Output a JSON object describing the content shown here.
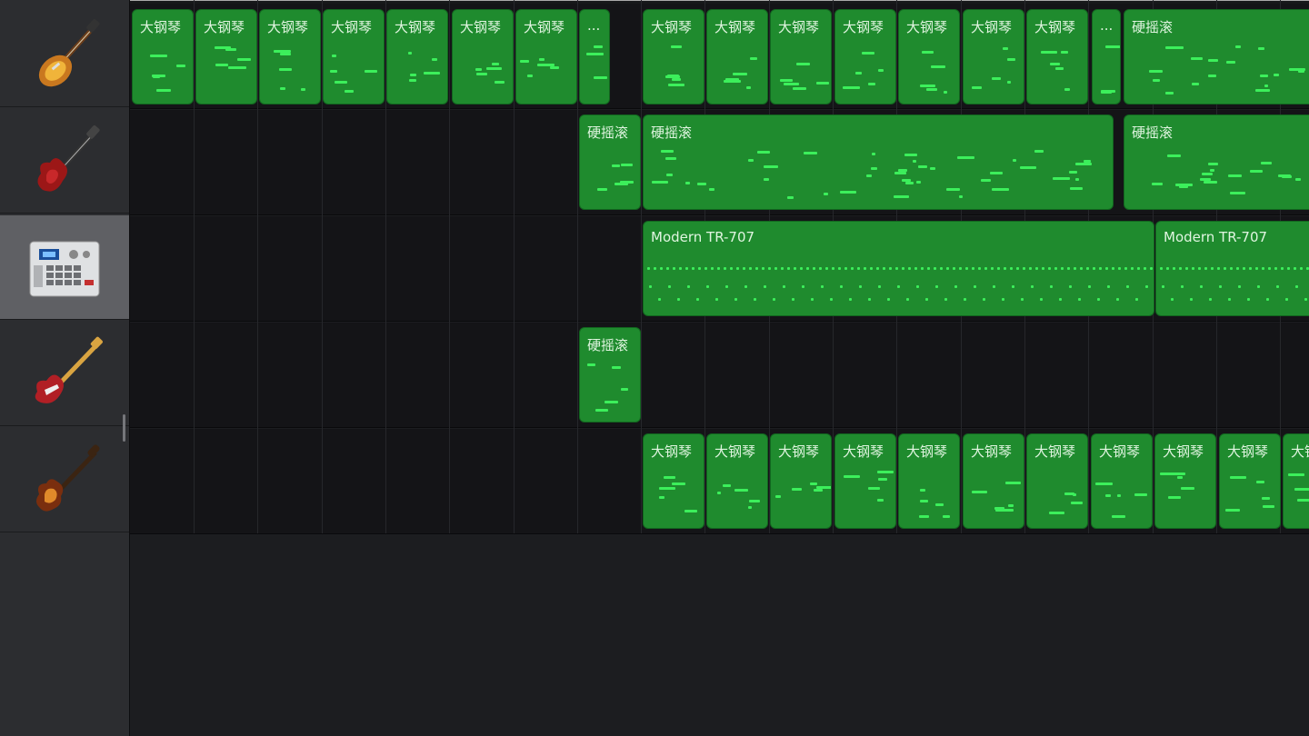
{
  "tracks": [
    {
      "name": "les-paul-guitar",
      "icon": "electric-guitar-sunburst-icon",
      "selected": false
    },
    {
      "name": "sg-guitar",
      "icon": "electric-guitar-red-icon",
      "selected": false
    },
    {
      "name": "drum-machine",
      "icon": "drum-machine-icon",
      "selected": true
    },
    {
      "name": "bass-guitar",
      "icon": "bass-guitar-red-icon",
      "selected": false
    },
    {
      "name": "violin-bass",
      "icon": "violin-bass-icon",
      "selected": false
    }
  ],
  "regions": [
    [
      {
        "label": "大钢琴"
      },
      {
        "label": "大钢琴"
      },
      {
        "label": "大钢琴"
      },
      {
        "label": "大钢琴"
      },
      {
        "label": "大钢琴"
      },
      {
        "label": "大钢琴"
      },
      {
        "label": "大钢琴"
      },
      {
        "label": "..."
      },
      {
        "label": "大钢琴"
      },
      {
        "label": "大钢琴"
      },
      {
        "label": "大钢琴"
      },
      {
        "label": "大钢琴"
      },
      {
        "label": "大钢琴"
      },
      {
        "label": "大钢琴"
      },
      {
        "label": "大钢琴"
      },
      {
        "label": "..."
      },
      {
        "label": "硬摇滚"
      }
    ],
    [
      {
        "label": "硬摇滚"
      },
      {
        "label": "硬摇滚"
      },
      {
        "label": "硬摇滚"
      }
    ],
    [
      {
        "label": "Modern TR-707"
      },
      {
        "label": "Modern TR-707"
      }
    ],
    [
      {
        "label": "硬摇滚"
      }
    ],
    [
      {
        "label": "大钢琴"
      },
      {
        "label": "大钢琴"
      },
      {
        "label": "大钢琴"
      },
      {
        "label": "大钢琴"
      },
      {
        "label": "大钢琴"
      },
      {
        "label": "大钢琴"
      },
      {
        "label": "大钢琴"
      },
      {
        "label": "大钢琴"
      },
      {
        "label": "大钢琴"
      },
      {
        "label": "大钢琴"
      },
      {
        "label": "大钢"
      }
    ]
  ],
  "colors": {
    "region": "#1f8b2e",
    "note": "#3cef5b",
    "selected_header": "#5f6064"
  }
}
